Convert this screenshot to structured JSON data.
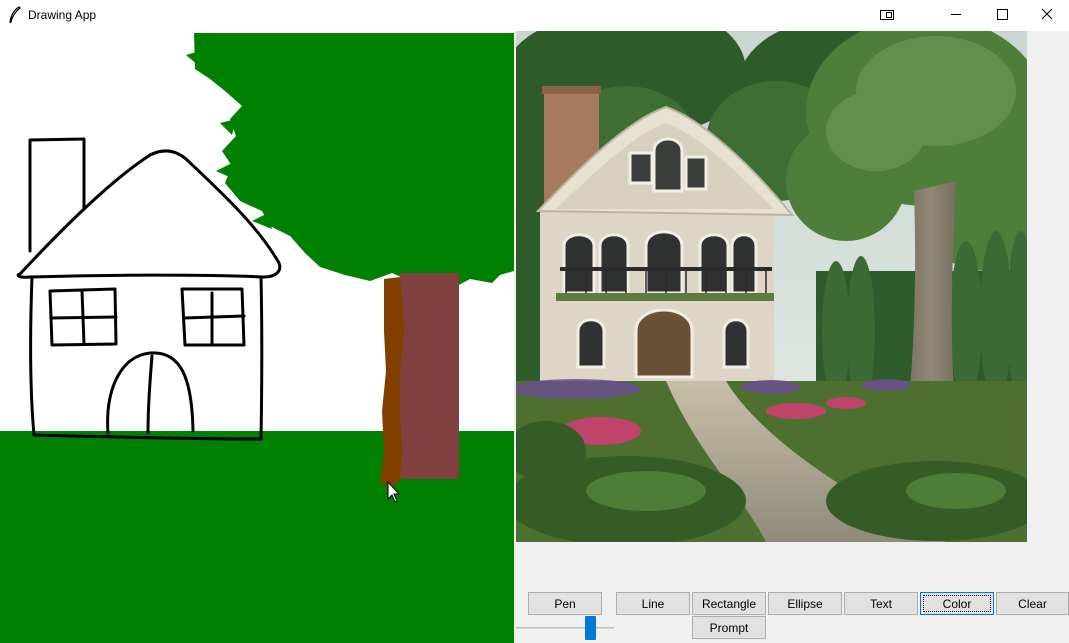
{
  "window": {
    "title": "Drawing App",
    "controls": {
      "extra": "window-snap-icon",
      "minimize": "minimize-icon",
      "maximize": "maximize-icon",
      "close": "close-icon"
    }
  },
  "canvas": {
    "background": "#ffffff",
    "ground_color": "#008000",
    "foliage_color": "#008000",
    "trunk_color": "#804000",
    "trunk_shadow_color": "#804040",
    "outline_color": "#000000"
  },
  "toolbar": {
    "pen": "Pen",
    "line": "Line",
    "rectangle": "Rectangle",
    "ellipse": "Ellipse",
    "text": "Text",
    "color": "Color",
    "clear": "Clear",
    "prompt": "Prompt"
  },
  "brush_size": {
    "value_fraction": 0.79
  },
  "colors": {
    "accent": "#0078d7",
    "button_face": "#e1e1e1",
    "button_border": "#adadad"
  }
}
